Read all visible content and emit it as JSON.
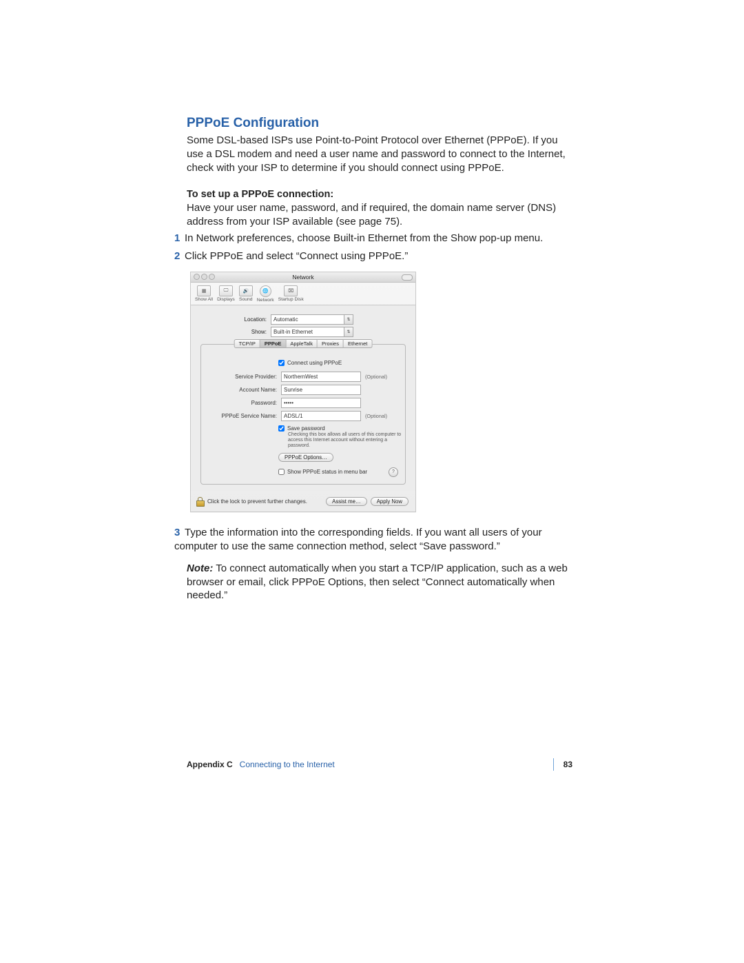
{
  "heading": "PPPoE Configuration",
  "intro": "Some DSL-based ISPs use Point-to-Point Protocol over Ethernet (PPPoE). If you use a DSL modem and need a user name and password to connect to the Internet, check with your ISP to determine if you should connect using PPPoE.",
  "setup_heading": "To set up a PPPoE connection:",
  "setup_text": "Have your user name, password, and if required, the domain name server (DNS) address from your ISP available (see page 75).",
  "steps": [
    "In Network preferences, choose Built-in Ethernet from the Show pop-up menu.",
    "Click PPPoE and select “Connect using PPPoE.”",
    "Type the information into the corresponding fields. If you want all users of your computer to use the same connection method, select “Save password.”"
  ],
  "note_label": "Note:",
  "note_text": "  To connect automatically when you start a TCP/IP application, such as a web browser or email, click PPPoE Options, then select “Connect automatically when needed.”",
  "window": {
    "title": "Network",
    "toolbar": [
      {
        "label": "Show All"
      },
      {
        "label": "Displays"
      },
      {
        "label": "Sound"
      },
      {
        "label": "Network"
      },
      {
        "label": "Startup Disk"
      }
    ],
    "location_label": "Location:",
    "location_value": "Automatic",
    "show_label": "Show:",
    "show_value": "Built-in Ethernet",
    "tabs": [
      "TCP/IP",
      "PPPoE",
      "AppleTalk",
      "Proxies",
      "Ethernet"
    ],
    "active_tab": "PPPoE",
    "connect_label": "Connect using PPPoE",
    "fields": {
      "service_provider": {
        "label": "Service Provider:",
        "value": "NorthernWest",
        "optional": "(Optional)"
      },
      "account_name": {
        "label": "Account Name:",
        "value": "Sunrise"
      },
      "password": {
        "label": "Password:",
        "value": "•••••"
      },
      "pppoe_service": {
        "label": "PPPoE Service Name:",
        "value": "ADSL/1",
        "optional": "(Optional)"
      }
    },
    "save_password_label": "Save password",
    "save_password_hint": "Checking this box allows all users of this computer to access this Internet account without entering a password.",
    "pppoe_options_btn": "PPPoE Options…",
    "menubar_label": "Show PPPoE status in menu bar",
    "lock_text": "Click the lock to prevent further changes.",
    "assist_btn": "Assist me…",
    "apply_btn": "Apply Now"
  },
  "footer": {
    "appendix": "Appendix C",
    "chapter": "Connecting to the Internet",
    "page": "83"
  }
}
